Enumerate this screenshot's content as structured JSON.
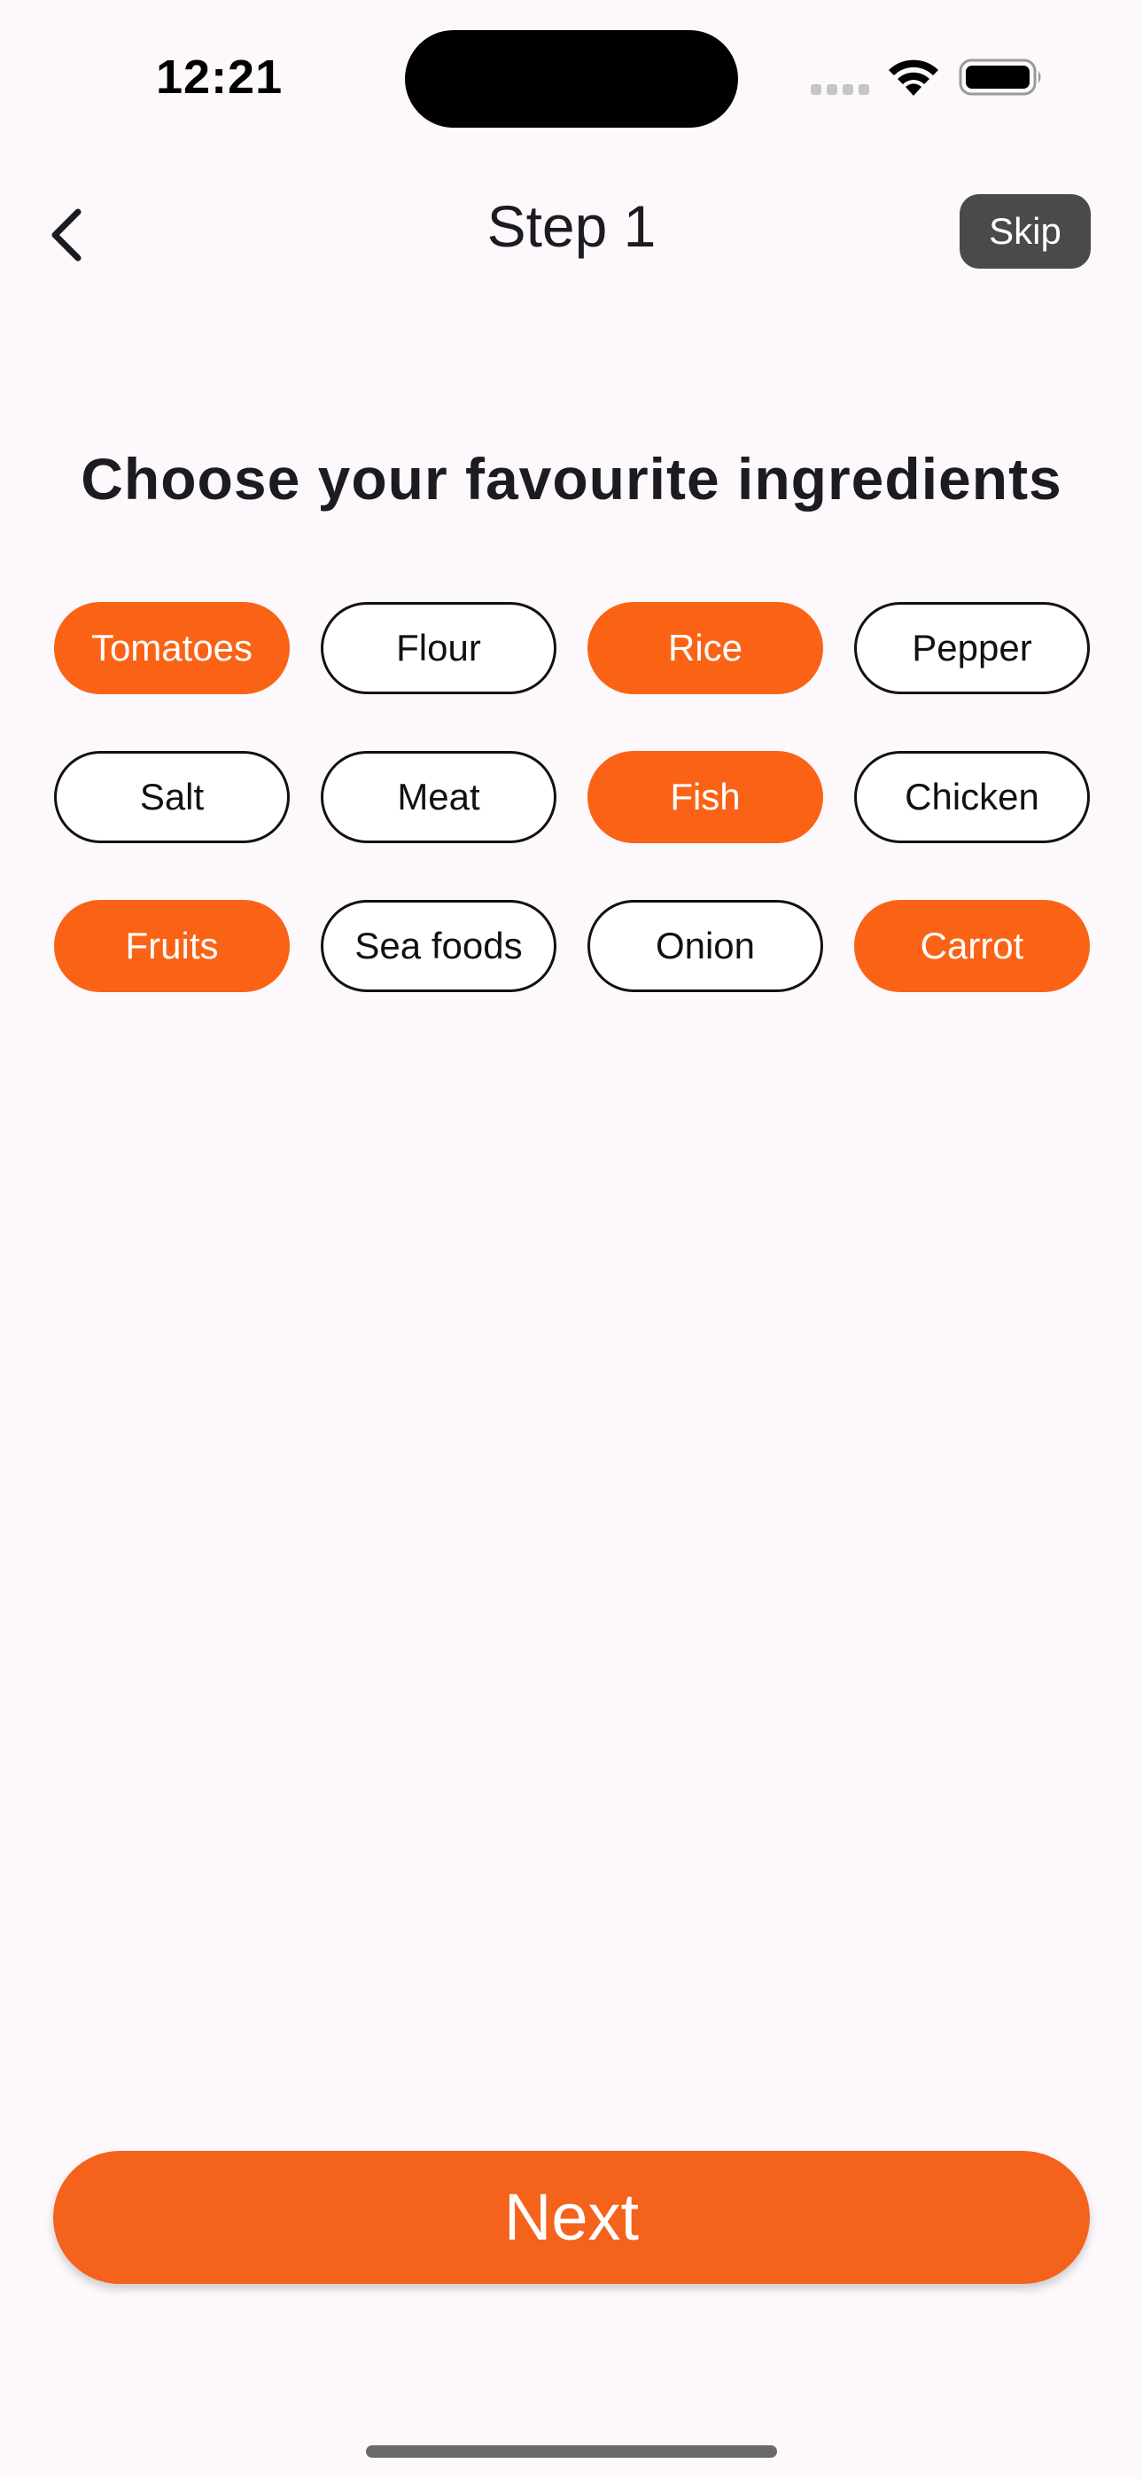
{
  "status_bar": {
    "time": "12:21",
    "icons": [
      "cellular-signal-icon",
      "wifi-icon",
      "battery-icon"
    ]
  },
  "header": {
    "back_icon": "chevron-left-icon",
    "title": "Step 1",
    "skip_label": "Skip"
  },
  "heading": "Choose your favourite ingredients",
  "ingredients": [
    {
      "label": "Tomatoes",
      "selected": true
    },
    {
      "label": "Flour",
      "selected": false
    },
    {
      "label": "Rice",
      "selected": true
    },
    {
      "label": "Pepper",
      "selected": false
    },
    {
      "label": "Salt",
      "selected": false
    },
    {
      "label": "Meat",
      "selected": false
    },
    {
      "label": "Fish",
      "selected": true
    },
    {
      "label": "Chicken",
      "selected": false
    },
    {
      "label": "Fruits",
      "selected": true
    },
    {
      "label": "Sea foods",
      "selected": false
    },
    {
      "label": "Onion",
      "selected": false
    },
    {
      "label": "Carrot",
      "selected": true
    }
  ],
  "next_label": "Next",
  "colors": {
    "accent": "#fa6316",
    "button": "#f4621c",
    "skip_background": "#4a4a4a",
    "background": "#fdf8fb",
    "text": "#1c1b1f"
  }
}
